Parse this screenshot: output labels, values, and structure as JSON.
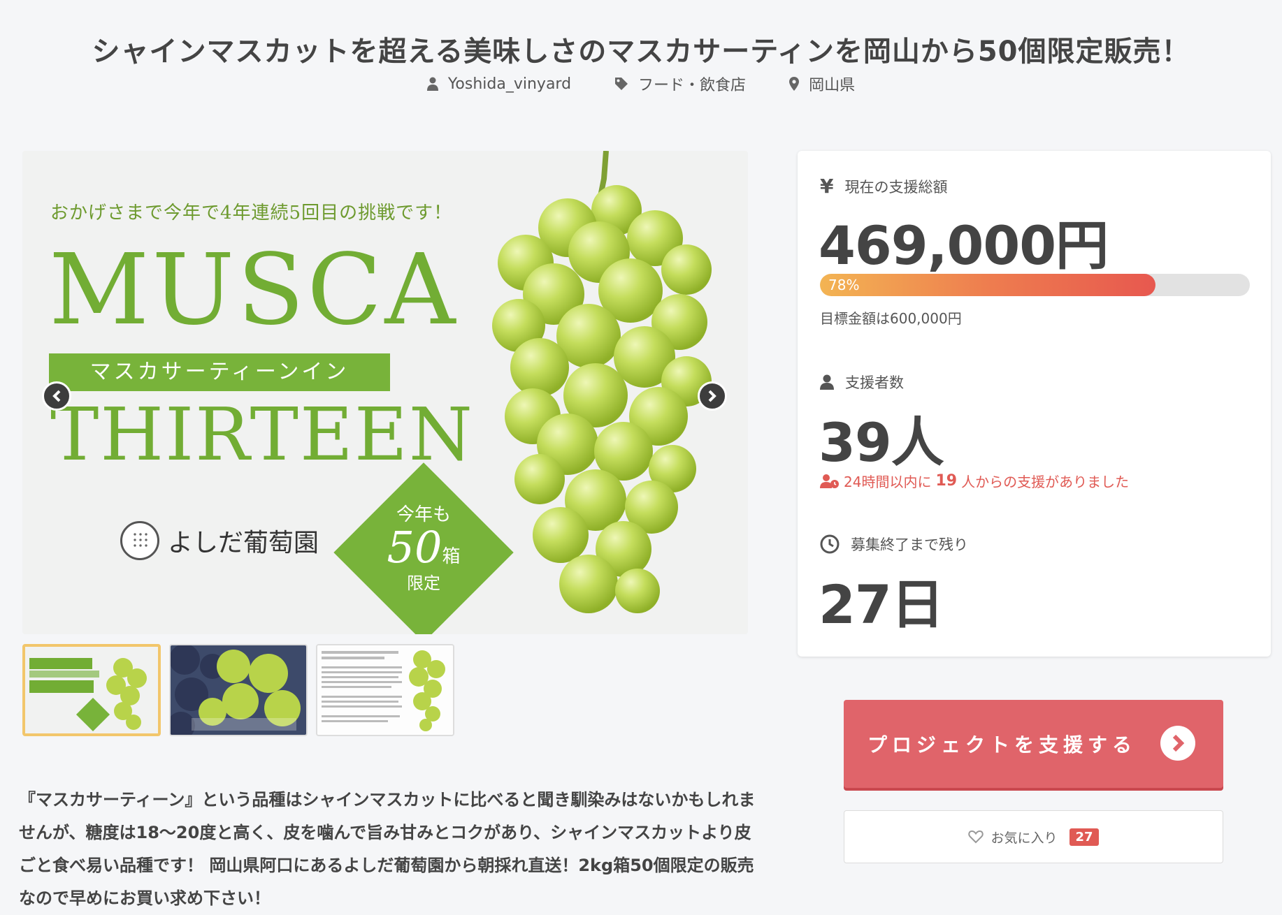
{
  "title": "シャインマスカットを超える美味しさのマスカサーティンを岡山から50個限定販売！",
  "meta": {
    "owner": "Yoshida_vinyard",
    "category": "フード・飲食店",
    "location": "岡山県"
  },
  "gallery": {
    "headline": "おかげさまで今年で4年連続5回目の挑戦です！",
    "word_musca": "MUSCA",
    "band": "マスカサーティーンイン",
    "word_thirteen": "THIRTEEN",
    "brand": "よしだ葡萄園",
    "badge_line1": "今年も",
    "badge_line2": "50",
    "badge_unit": "箱",
    "badge_line3": "限定"
  },
  "description": "『マスカサーティーン』という品種はシャインマスカットに比べると聞き馴染みはないかもしれませんが、糖度は18〜20度と高く、皮を噛んで旨み甘みとコクがあり、シャインマスカットより皮ごと食べ易い品種です！ 岡山県阿口にあるよしだ葡萄園から朝採れ直送！2kg箱50個限定の販売なので早めにお買い求め下さい！",
  "stats": {
    "total_label": "現在の支援総額",
    "total_value": "469,000円",
    "progress_label": "78%",
    "progress_fraction": 0.78,
    "goal_text": "目標金額は600,000円",
    "supporters_label": "支援者数",
    "supporters_value": "39人",
    "recent_prefix": "24時間以内に",
    "recent_count": "19",
    "recent_suffix": "人からの支援がありました",
    "remaining_label": "募集終了まで残り",
    "remaining_value": "27日"
  },
  "actions": {
    "support_label": "プロジェクトを支援する",
    "favorite_label": "お気に入り",
    "favorite_count": "27"
  },
  "colors": {
    "accent": "#e0646a",
    "grape_green": "#72ad34",
    "alert_red": "#e05a54",
    "thumb_highlight": "#f2c66b"
  }
}
